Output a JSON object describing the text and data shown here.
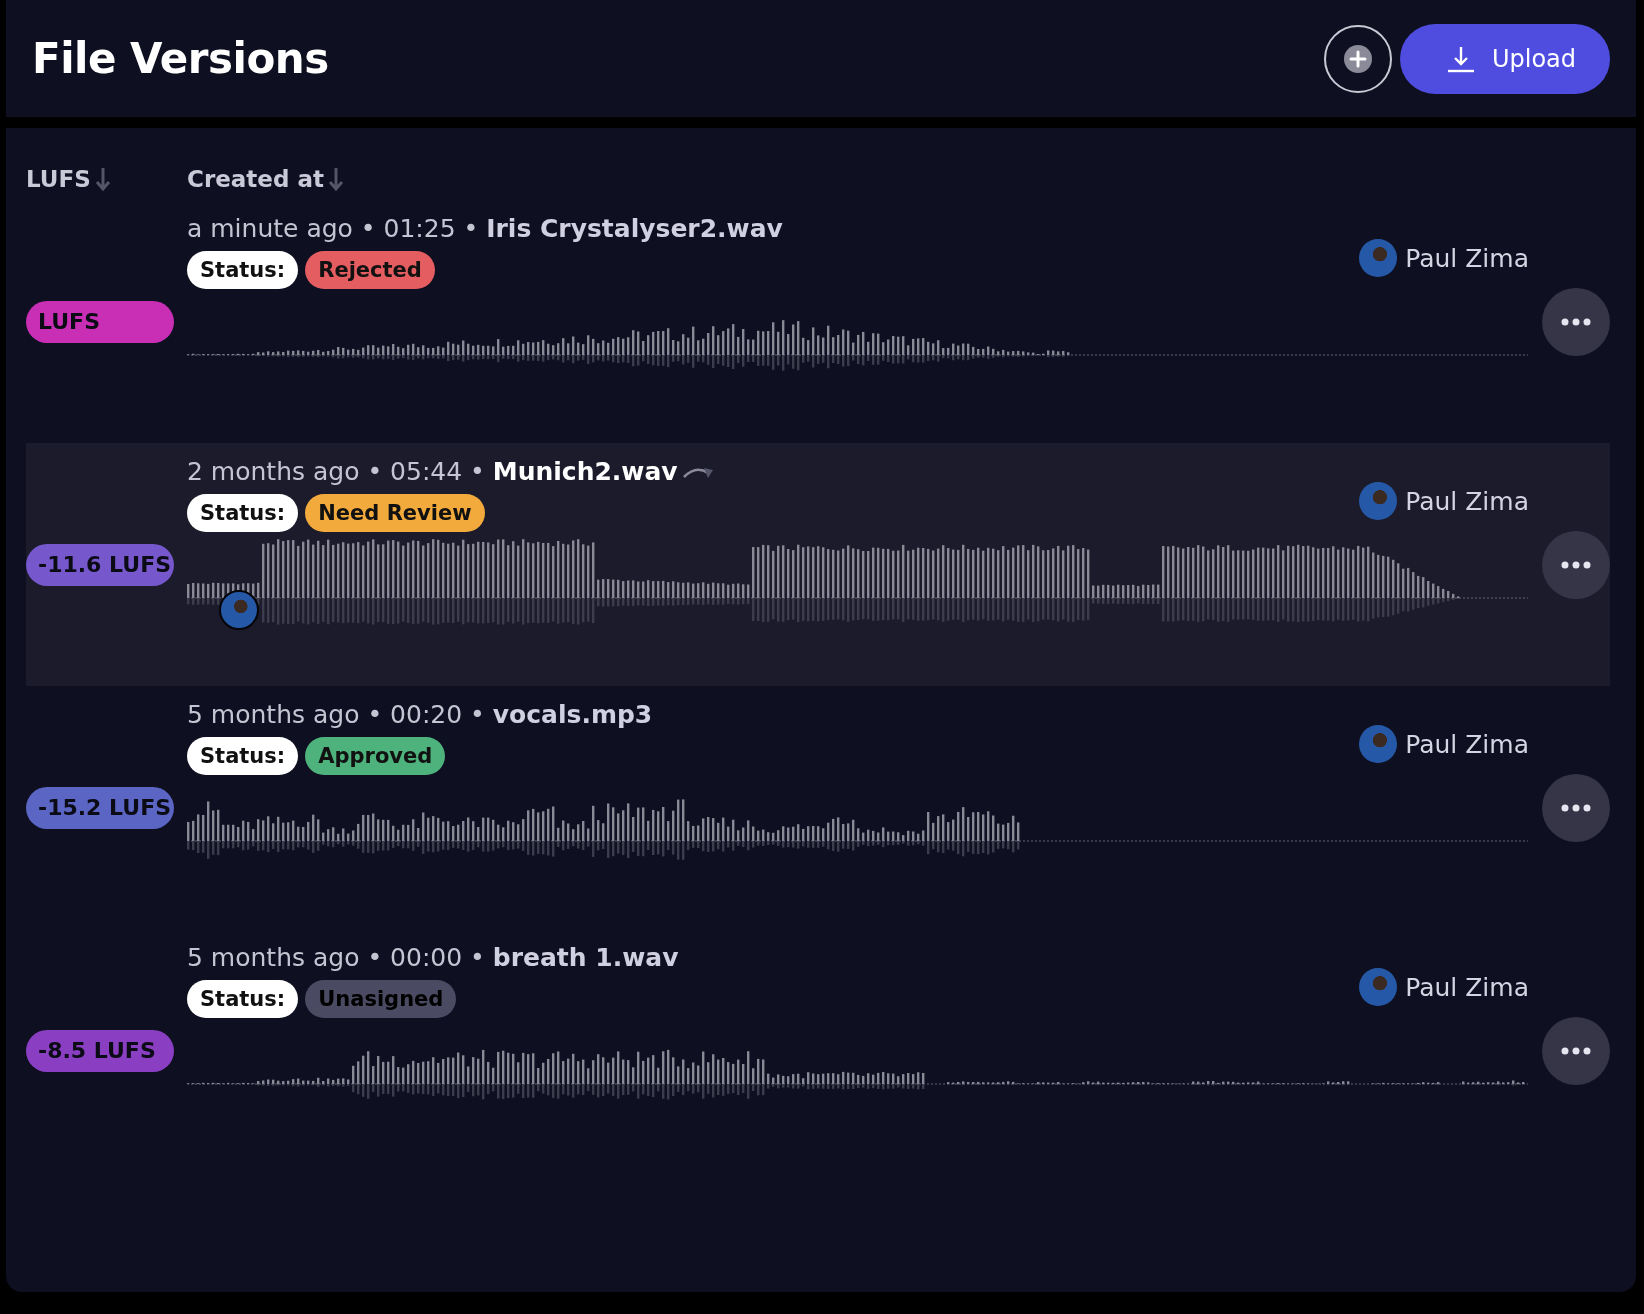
{
  "header": {
    "title": "File Versions",
    "upload_button": "Upload"
  },
  "table": {
    "columns": [
      {
        "label": "LUFS"
      },
      {
        "label": "Created at"
      }
    ],
    "rows": [
      {
        "selected": false,
        "lufs": "LUFS",
        "color": "#c92fb5",
        "meta": "a minute ago • 01:25 •",
        "filename": "Iris Crystalyser2.wav",
        "forwarded": false,
        "status_label": "Status:",
        "status": {
          "label": "Rejected",
          "kind": "rejected"
        },
        "user": "Paul Zima",
        "comment_marker": false
      },
      {
        "selected": true,
        "lufs": "-11.6 LUFS",
        "color": "#7658cc",
        "meta": "2 months ago • 05:44 •",
        "filename": "Munich2.wav",
        "forwarded": true,
        "status_label": "Status:",
        "status": {
          "label": "Need Review",
          "kind": "review"
        },
        "user": "Paul Zima",
        "comment_marker": true
      },
      {
        "selected": false,
        "lufs": "-15.2 LUFS",
        "color": "#5b65c4",
        "meta": "5 months ago • 00:20 •",
        "filename": "vocals.mp3",
        "forwarded": false,
        "status_label": "Status:",
        "status": {
          "label": "Approved",
          "kind": "approved"
        },
        "user": "Paul Zima",
        "comment_marker": false
      },
      {
        "selected": false,
        "lufs": "-8.5 LUFS",
        "color": "#8a3fc2",
        "meta": "5 months ago • 00:00 •",
        "filename": "breath 1.wav",
        "forwarded": false,
        "status_label": "Status:",
        "status": {
          "label": "Unasigned",
          "kind": "unassigned"
        },
        "user": "Paul Zima",
        "comment_marker": false
      }
    ]
  }
}
